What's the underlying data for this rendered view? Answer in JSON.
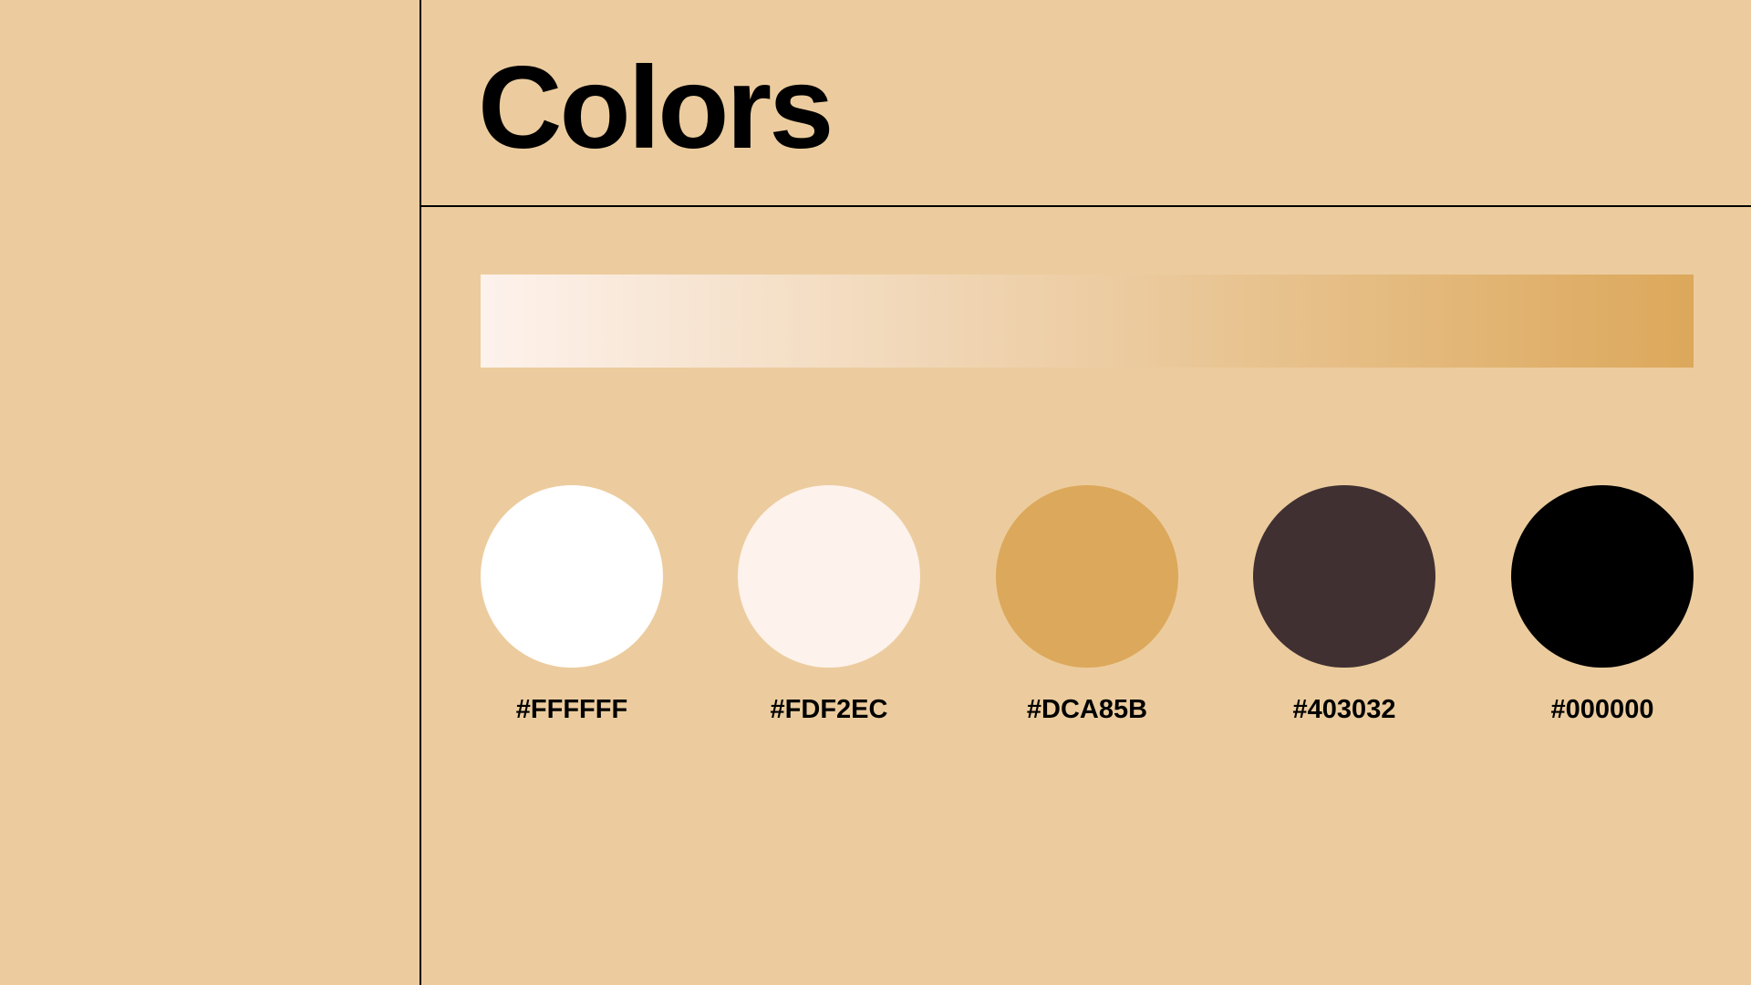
{
  "title": "Colors",
  "gradient": {
    "from": "#FDF2EC",
    "to": "#DCA85B"
  },
  "swatches": [
    {
      "color": "#FFFFFF",
      "label": "#FFFFFF"
    },
    {
      "color": "#FDF2EC",
      "label": "#FDF2EC"
    },
    {
      "color": "#DCA85B",
      "label": "#DCA85B"
    },
    {
      "color": "#403032",
      "label": "#403032"
    },
    {
      "color": "#000000",
      "label": "#000000"
    }
  ],
  "theme": {
    "background": "#ECCC9E",
    "line": "#000000",
    "text": "#000000"
  }
}
